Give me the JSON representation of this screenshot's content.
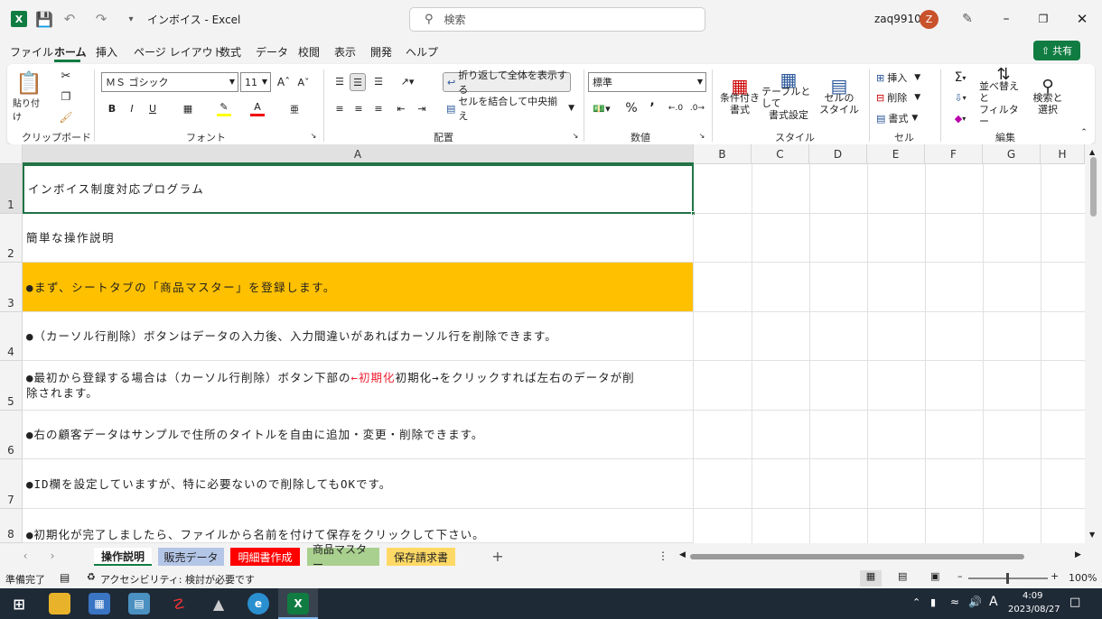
{
  "window": {
    "title": "インボイス  -  Excel",
    "search_placeholder": "検索",
    "user_name": "zaq9910",
    "avatar_initial": "Z",
    "share_label": "共有"
  },
  "ribbon_tabs": [
    "ファイル",
    "ホーム",
    "挿入",
    "ページ レイアウト",
    "数式",
    "データ",
    "校閲",
    "表示",
    "開発",
    "ヘルプ"
  ],
  "ribbon": {
    "clipboard": {
      "label": "クリップボード",
      "paste": "貼り付け"
    },
    "font": {
      "label": "フォント",
      "name": "ＭＳ ゴシック",
      "size": "11",
      "bold": "B",
      "italic": "I",
      "underline": "U"
    },
    "alignment": {
      "label": "配置",
      "wrap_text": "折り返して全体を表示する",
      "merge_center": "セルを結合して中央揃え"
    },
    "number": {
      "label": "数値",
      "format": "標準"
    },
    "styles": {
      "label": "スタイル",
      "conditional": [
        "条件付き",
        "書式"
      ],
      "table": [
        "テーブルとして",
        "書式設定"
      ],
      "cell_styles": [
        "セルの",
        "スタイル"
      ]
    },
    "cells": {
      "label": "セル",
      "insert": "挿入",
      "delete": "削除",
      "format": "書式"
    },
    "editing": {
      "label": "編集",
      "sort": [
        "並べ替えと",
        "フィルター"
      ],
      "find": [
        "検索と",
        "選択"
      ]
    }
  },
  "columns": [
    "A",
    "B",
    "C",
    "D",
    "E",
    "F",
    "G",
    "H"
  ],
  "rows": [
    "1",
    "2",
    "3",
    "4",
    "5",
    "6",
    "7",
    "8"
  ],
  "cells": {
    "r1": "インボイス制度対応プログラム",
    "r2": "簡単な操作説明",
    "r3": "●まず、シートタブの「商品マスター」を登録します。",
    "r4": "●（カーソル行削除）ボタンはデータの入力後、入力間違いがあればカーソル行を削除できます。",
    "r5a": "●最初から登録する場合は（カーソル行削除）ボタン下部の",
    "r5red": "←初期化",
    "r5b": "初期化→をクリックすれば左右のデータが削",
    "r5c": "除されます。",
    "r6": "●右の顧客データはサンプルで住所のタイトルを自由に追加・変更・削除できます。",
    "r7": "●ID欄を設定していますが、特に必要ないので削除してもOKです。",
    "r8": "●初期化が完了しましたら、ファイルから名前を付けて保存をクリックして下さい。"
  },
  "sheet_tabs": [
    {
      "label": "操作説明",
      "color": "#ffffff"
    },
    {
      "label": "販売データ",
      "color": "#b4c6e7"
    },
    {
      "label": "明細書作成",
      "color": "#ff0000"
    },
    {
      "label": "商品マスター",
      "color": "#a9d08e"
    },
    {
      "label": "保存請求書",
      "color": "#ffd966"
    }
  ],
  "status": {
    "ready": "準備完了",
    "accessibility": "アクセシビリティ: 検討が必要です",
    "zoom": "100%"
  },
  "taskbar": {
    "time": "4:09",
    "date": "2023/08/27",
    "ime": "A"
  },
  "colors": {
    "accent_green": "#107c41",
    "highlight": "#ffc000",
    "selection_border": "#217346"
  }
}
